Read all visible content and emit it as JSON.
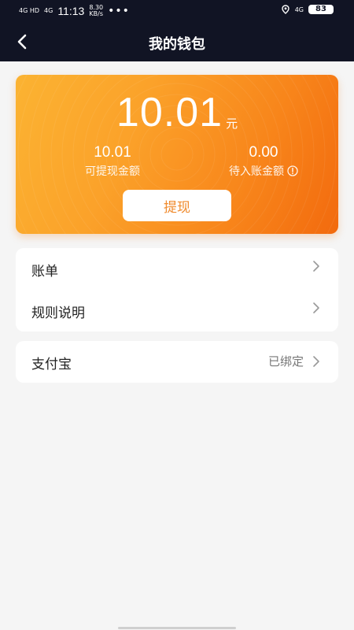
{
  "status_bar": {
    "signal_1": "4G HD",
    "signal_2": "4G",
    "time": "11:13",
    "speed_value": "8.30",
    "speed_unit": "KB/s",
    "more": "•••",
    "network": "4G",
    "battery": "83"
  },
  "header": {
    "title": "我的钱包",
    "back_icon": "chevron-left-icon"
  },
  "wallet": {
    "balance": "10.01",
    "unit": "元",
    "withdrawable_value": "10.01",
    "withdrawable_label": "可提现金额",
    "pending_value": "0.00",
    "pending_label": "待入账金额",
    "withdraw_button": "提现",
    "colors": {
      "gradient_start": "#fbb332",
      "gradient_end": "#f26a0e",
      "button_text": "#f08a2c"
    }
  },
  "menu": {
    "items": [
      {
        "label": "账单"
      },
      {
        "label": "规则说明"
      }
    ]
  },
  "payment": {
    "label": "支付宝",
    "status": "已绑定"
  },
  "colors": {
    "topbar": "#111424",
    "background": "#f5f5f5"
  }
}
